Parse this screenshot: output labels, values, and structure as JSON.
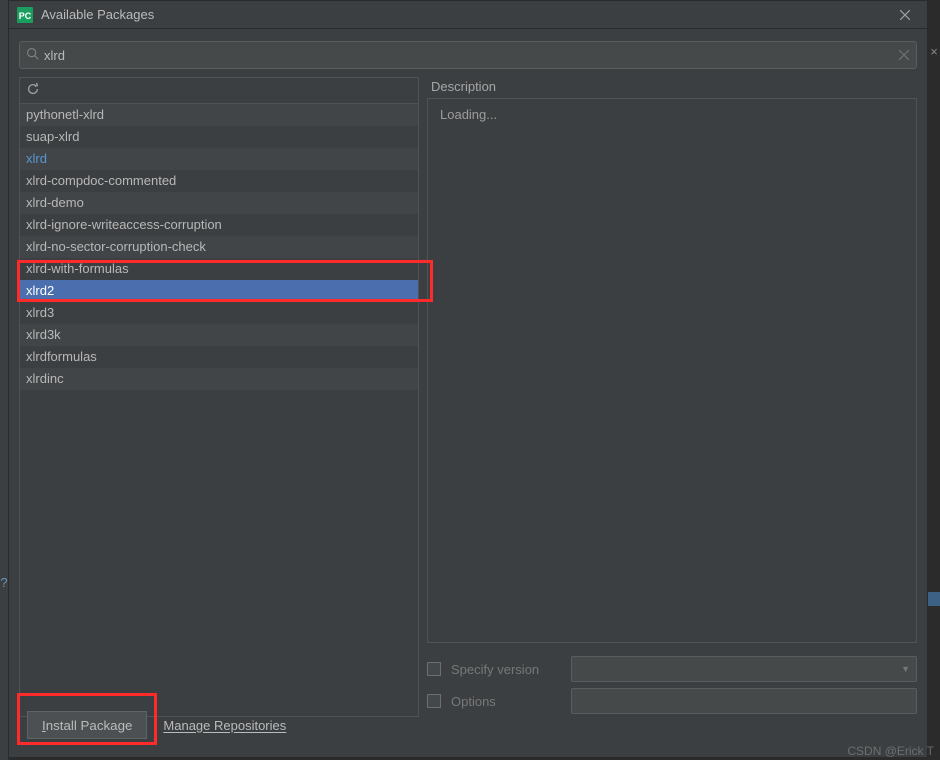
{
  "window": {
    "title": "Available Packages"
  },
  "search": {
    "value": "xlrd"
  },
  "packages": {
    "items": [
      {
        "name": "pythonetl-xlrd"
      },
      {
        "name": "suap-xlrd"
      },
      {
        "name": "xlrd",
        "highlight": true
      },
      {
        "name": "xlrd-compdoc-commented"
      },
      {
        "name": "xlrd-demo"
      },
      {
        "name": "xlrd-ignore-writeaccess-corruption"
      },
      {
        "name": "xlrd-no-sector-corruption-check"
      },
      {
        "name": "xlrd-with-formulas"
      },
      {
        "name": "xlrd2",
        "selected": true
      },
      {
        "name": "xlrd3"
      },
      {
        "name": "xlrd3k"
      },
      {
        "name": "xlrdformulas"
      },
      {
        "name": "xlrdinc"
      }
    ]
  },
  "description": {
    "label": "Description",
    "text": "Loading..."
  },
  "options": {
    "specify_version_label": "Specify version",
    "options_label": "Options"
  },
  "footer": {
    "install_label": "Install Package",
    "manage_label": "Manage Repositories"
  },
  "watermark": "CSDN @Erick T"
}
